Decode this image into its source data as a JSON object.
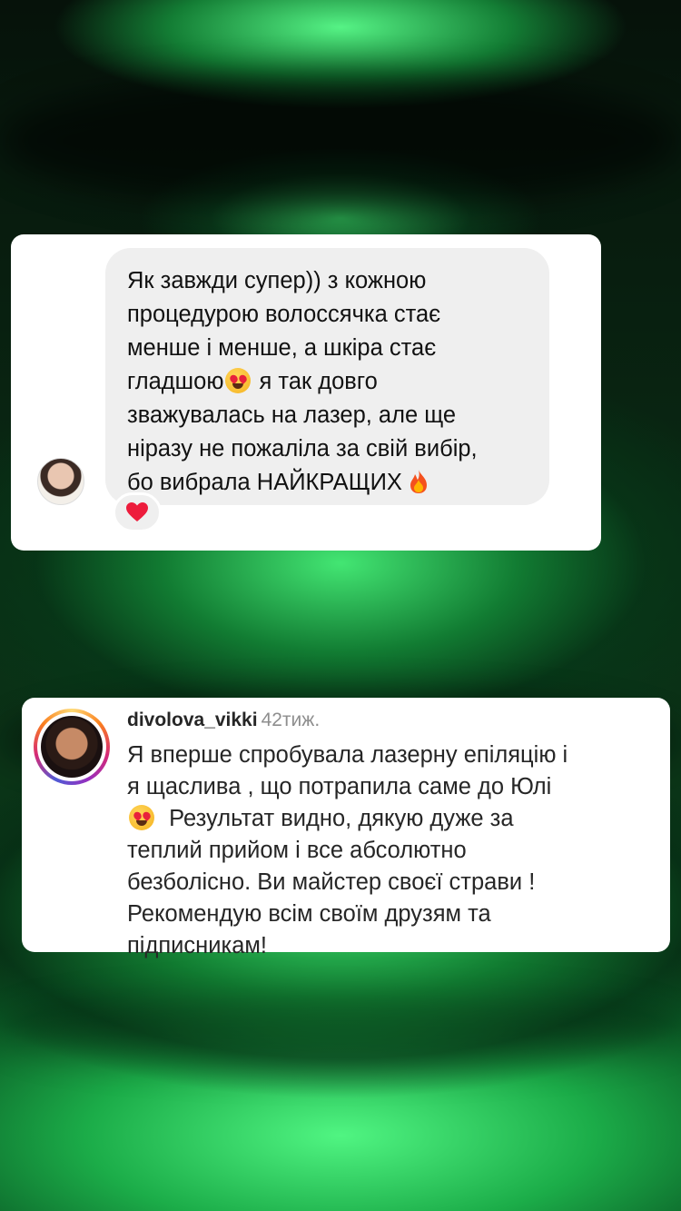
{
  "dm_message": {
    "line_1": "Як завжди супер)) з кожною",
    "line_2": "процедурою волоссячка стає",
    "line_3": "менше і менше, а шкіра стає",
    "line_4_before": "гладшою",
    "line_4_after": " я так довго",
    "line_5": "зважувалась на лазер, але ще",
    "line_6": "ніразу не пожаліла за свій вибір,",
    "line_7": "бо вибрала НАЙКРАЩИХ",
    "reaction": "❤️"
  },
  "comment": {
    "username": "divolova_vikki",
    "time": "42тиж.",
    "line_1": "Я вперше спробувала лазерну епіляцію і",
    "line_2": "я щаслива , що потрапила саме до Юлі",
    "line_3_after_emoji": "  Результат видно, дякую дуже за",
    "line_4": "теплий прийом і все абсолютно",
    "line_5": "безболісно. Ви майстер своєї страви !",
    "line_6": "Рекомендую всім своїм друзям та",
    "line_7": "підписникам!"
  },
  "colors": {
    "background_glow": "#2fd25f",
    "bubble": "#efefef",
    "card": "#ffffff",
    "heart": "#ed1c3c"
  }
}
